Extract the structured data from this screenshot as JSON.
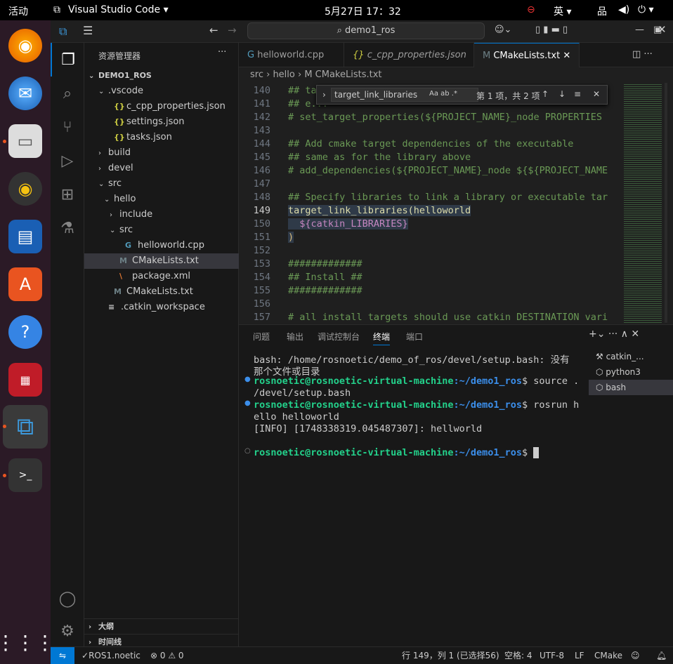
{
  "topbar": {
    "activities": "活动",
    "app": "Visual Studio Code ▾",
    "clock": "5月27日  17：32",
    "lang": "英 ▾"
  },
  "titlebar": {
    "search": "demo1_ros"
  },
  "sidebar": {
    "title": "资源管理器",
    "root": "DEMO1_ROS",
    "items": [
      {
        "label": ".vscode",
        "arrow": "⌄",
        "icon": "",
        "indent": 20
      },
      {
        "label": "c_cpp_properties.json",
        "arrow": "",
        "icon": "{}",
        "indent": 28
      },
      {
        "label": "settings.json",
        "arrow": "",
        "icon": "{}",
        "indent": 28
      },
      {
        "label": "tasks.json",
        "arrow": "",
        "icon": "{}",
        "indent": 28
      },
      {
        "label": "build",
        "arrow": "›",
        "icon": "",
        "indent": 20
      },
      {
        "label": "devel",
        "arrow": "›",
        "icon": "",
        "indent": 20
      },
      {
        "label": "src",
        "arrow": "⌄",
        "icon": "",
        "indent": 20
      },
      {
        "label": "hello",
        "arrow": "⌄",
        "icon": "",
        "indent": 28
      },
      {
        "label": "include",
        "arrow": "›",
        "icon": "",
        "indent": 36
      },
      {
        "label": "src",
        "arrow": "⌄",
        "icon": "",
        "indent": 36
      },
      {
        "label": "helloworld.cpp",
        "arrow": "",
        "icon": "G",
        "indent": 44
      },
      {
        "label": "CMakeLists.txt",
        "arrow": "",
        "icon": "M",
        "indent": 36
      },
      {
        "label": "package.xml",
        "arrow": "",
        "icon": "\\",
        "indent": 36
      },
      {
        "label": "CMakeLists.txt",
        "arrow": "",
        "icon": "M",
        "indent": 28
      },
      {
        "label": ".catkin_workspace",
        "arrow": "",
        "icon": "≡",
        "indent": 20
      }
    ],
    "outline": "大纲",
    "timeline": "时间线"
  },
  "tabs": [
    {
      "label": "helloworld.cpp",
      "icon": "G"
    },
    {
      "label": "c_cpp_properties.json",
      "icon": "{}"
    },
    {
      "label": "CMakeLists.txt",
      "icon": "M"
    }
  ],
  "breadcrumb": "src  ›  hello  ›  M  CMakeLists.txt",
  "find": {
    "query": "target_link_libraries",
    "result": "第 1 项，共 2 项"
  },
  "code": [
    {
      "n": "140",
      "t": "## target ..."
    },
    {
      "n": "141",
      "t": "## e..."
    },
    {
      "n": "142",
      "t": "# set_target_properties(${PROJECT_NAME}_node PROPERTIES"
    },
    {
      "n": "143",
      "t": ""
    },
    {
      "n": "144",
      "t": "## Add cmake target dependencies of the executable"
    },
    {
      "n": "145",
      "t": "## same as for the library above"
    },
    {
      "n": "146",
      "t": "# add_dependencies(${PROJECT_NAME}_node ${${PROJECT_NAME"
    },
    {
      "n": "147",
      "t": ""
    },
    {
      "n": "148",
      "t": "## Specify libraries to link a library or executable tar"
    },
    {
      "n": "149",
      "t": "target_link_libraries(helloworld"
    },
    {
      "n": "150",
      "t": "  ${catkin_LIBRARIES}"
    },
    {
      "n": "151",
      "t": ")"
    },
    {
      "n": "152",
      "t": ""
    },
    {
      "n": "153",
      "t": "#############"
    },
    {
      "n": "154",
      "t": "## Install ##"
    },
    {
      "n": "155",
      "t": "#############"
    },
    {
      "n": "156",
      "t": ""
    },
    {
      "n": "157",
      "t": "# all install targets should use catkin DESTINATION vari"
    }
  ],
  "panel": {
    "tabs": [
      "问题",
      "输出",
      "调试控制台",
      "终端",
      "端口"
    ],
    "terminal": {
      "l1": "bash: /home/rosnoetic/demo_of_ros/devel/setup.bash: 没有",
      "l2": "那个文件或目录",
      "user": "rosnoetic@rosnoetic-virtual-machine",
      "path": ":~/demo1_ros",
      "cmd1": "$ source .",
      "cmd1b": "/devel/setup.bash",
      "cmd2": "$ rosrun h",
      "cmd2b": "ello helloworld",
      "info": "[INFO] [1748338319.045487307]: hellworld",
      "prompt": "$ "
    },
    "terminals": [
      "catkin_...",
      "python3",
      "bash"
    ]
  },
  "status": {
    "branch": "ROS1.noetic",
    "problems": "⊗ 0 ⚠ 0",
    "pos": "行 149，列 1 (已选择56)",
    "spaces": "空格: 4",
    "enc": "UTF-8",
    "eol": "LF",
    "lang": "CMake"
  }
}
